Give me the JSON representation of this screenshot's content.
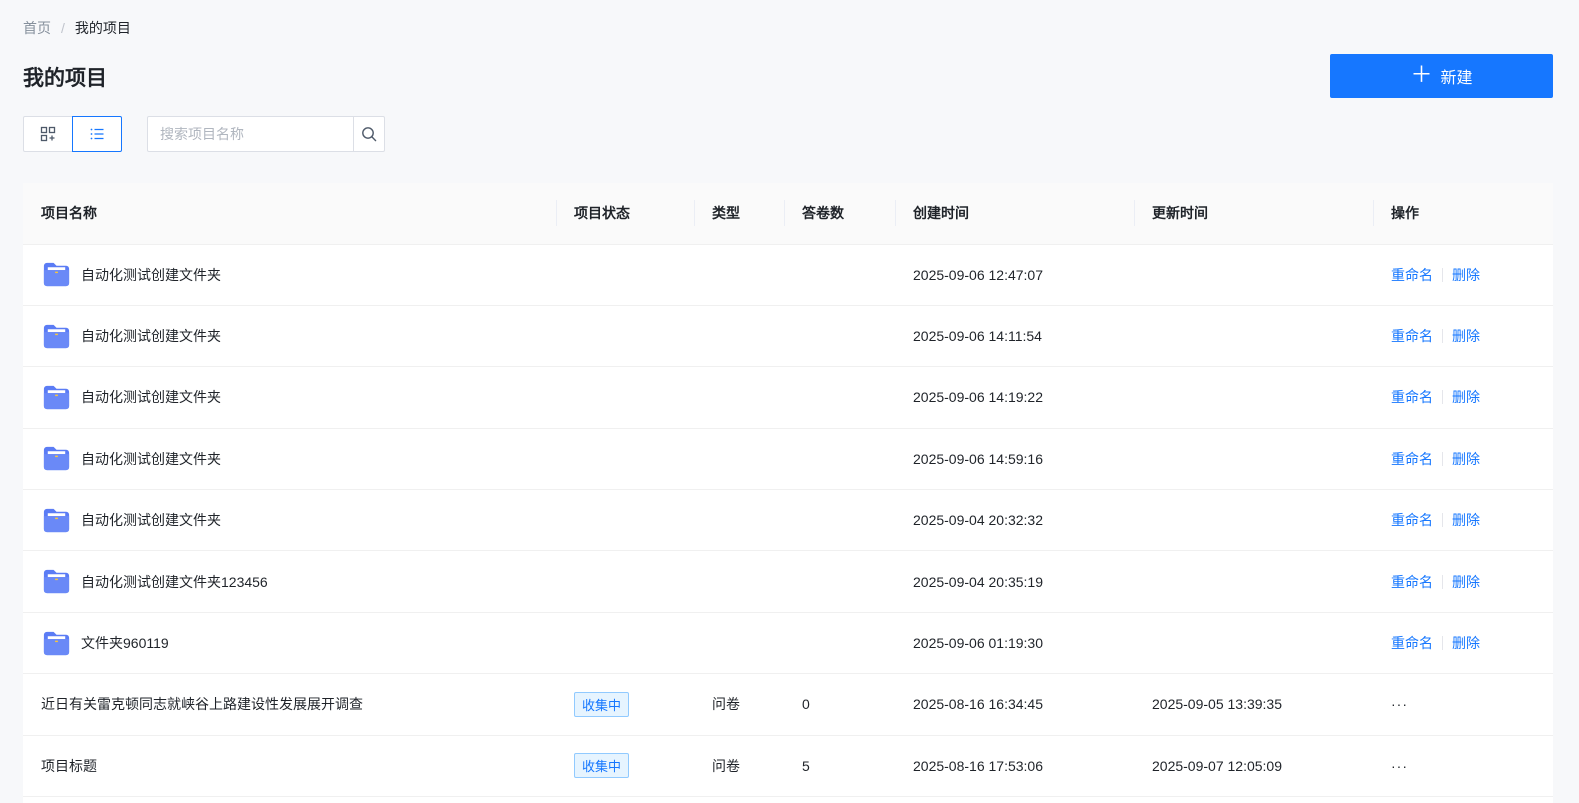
{
  "breadcrumb": {
    "home": "首页",
    "separator": "/",
    "current": "我的项目"
  },
  "page_title": "我的项目",
  "new_button": {
    "icon": "plus-icon",
    "label": "新建"
  },
  "view_toggle": {
    "grid_icon": "grid-view-icon",
    "list_icon": "list-view-icon",
    "active": "list"
  },
  "search": {
    "placeholder": "搜索项目名称",
    "value": "",
    "icon": "search-icon"
  },
  "colors": {
    "accent": "#1677ff",
    "folder": "#5b7cf5",
    "badge_bg": "#e6f4ff"
  },
  "table": {
    "columns": [
      "项目名称",
      "项目状态",
      "类型",
      "答卷数",
      "创建时间",
      "更新时间",
      "操作"
    ],
    "rows": [
      {
        "kind": "folder",
        "name": "自动化测试创建文件夹",
        "status": "",
        "type": "",
        "responses": "",
        "created": "2025-09-06 12:47:07",
        "updated": "",
        "actions": [
          "重命名",
          "删除"
        ]
      },
      {
        "kind": "folder",
        "name": "自动化测试创建文件夹",
        "status": "",
        "type": "",
        "responses": "",
        "created": "2025-09-06 14:11:54",
        "updated": "",
        "actions": [
          "重命名",
          "删除"
        ]
      },
      {
        "kind": "folder",
        "name": "自动化测试创建文件夹",
        "status": "",
        "type": "",
        "responses": "",
        "created": "2025-09-06 14:19:22",
        "updated": "",
        "actions": [
          "重命名",
          "删除"
        ]
      },
      {
        "kind": "folder",
        "name": "自动化测试创建文件夹",
        "status": "",
        "type": "",
        "responses": "",
        "created": "2025-09-06 14:59:16",
        "updated": "",
        "actions": [
          "重命名",
          "删除"
        ]
      },
      {
        "kind": "folder",
        "name": "自动化测试创建文件夹",
        "status": "",
        "type": "",
        "responses": "",
        "created": "2025-09-04 20:32:32",
        "updated": "",
        "actions": [
          "重命名",
          "删除"
        ]
      },
      {
        "kind": "folder",
        "name": "自动化测试创建文件夹123456",
        "status": "",
        "type": "",
        "responses": "",
        "created": "2025-09-04 20:35:19",
        "updated": "",
        "actions": [
          "重命名",
          "删除"
        ]
      },
      {
        "kind": "folder",
        "name": "文件夹960119",
        "status": "",
        "type": "",
        "responses": "",
        "created": "2025-09-06 01:19:30",
        "updated": "",
        "actions": [
          "重命名",
          "删除"
        ]
      },
      {
        "kind": "project",
        "name": "近日有关雷克顿同志就峡谷上路建设性发展展开调查",
        "status": "收集中",
        "type": "问卷",
        "responses": "0",
        "created": "2025-08-16 16:34:45",
        "updated": "2025-09-05 13:39:35",
        "more": "···"
      },
      {
        "kind": "project",
        "name": "项目标题",
        "status": "收集中",
        "type": "问卷",
        "responses": "5",
        "created": "2025-08-16 17:53:06",
        "updated": "2025-09-07 12:05:09",
        "more": "···"
      }
    ]
  }
}
